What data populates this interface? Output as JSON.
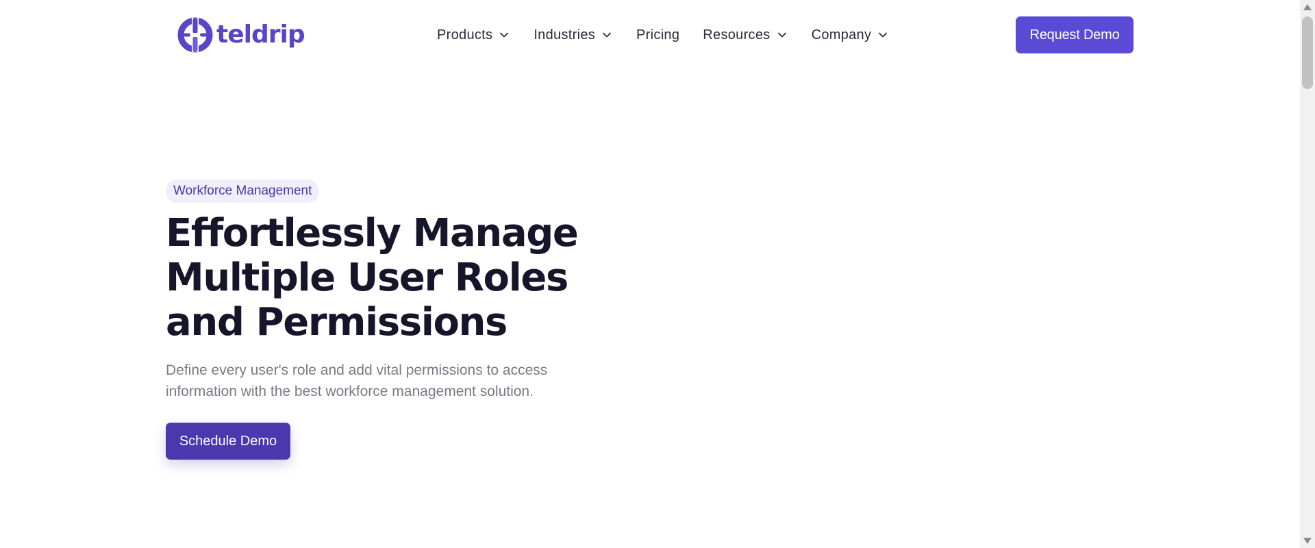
{
  "brand": {
    "name": "teldrip",
    "logo_icon": "teldrip-logo-mark",
    "color": "#5a45c8"
  },
  "nav": {
    "items": [
      {
        "label": "Products",
        "has_dropdown": true
      },
      {
        "label": "Industries",
        "has_dropdown": true
      },
      {
        "label": "Pricing",
        "has_dropdown": false
      },
      {
        "label": "Resources",
        "has_dropdown": true
      },
      {
        "label": "Company",
        "has_dropdown": true
      }
    ],
    "dropdown_icon": "chevron-down-icon"
  },
  "header": {
    "cta_label": "Request Demo",
    "cta_color": "#5a4ad6"
  },
  "hero": {
    "tag": "Workforce Management",
    "title": "Effortlessly Manage Multiple User Roles and Permissions",
    "subtitle": "Define every user's role and add vital permissions to access information with the best workforce management solution.",
    "cta_label": "Schedule Demo",
    "cta_color": "#4a38ad"
  },
  "colors": {
    "title_text": "#16152a",
    "subtitle_text": "#7a7985",
    "tag_bg": "#efeefb",
    "tag_text": "#473a9e"
  }
}
